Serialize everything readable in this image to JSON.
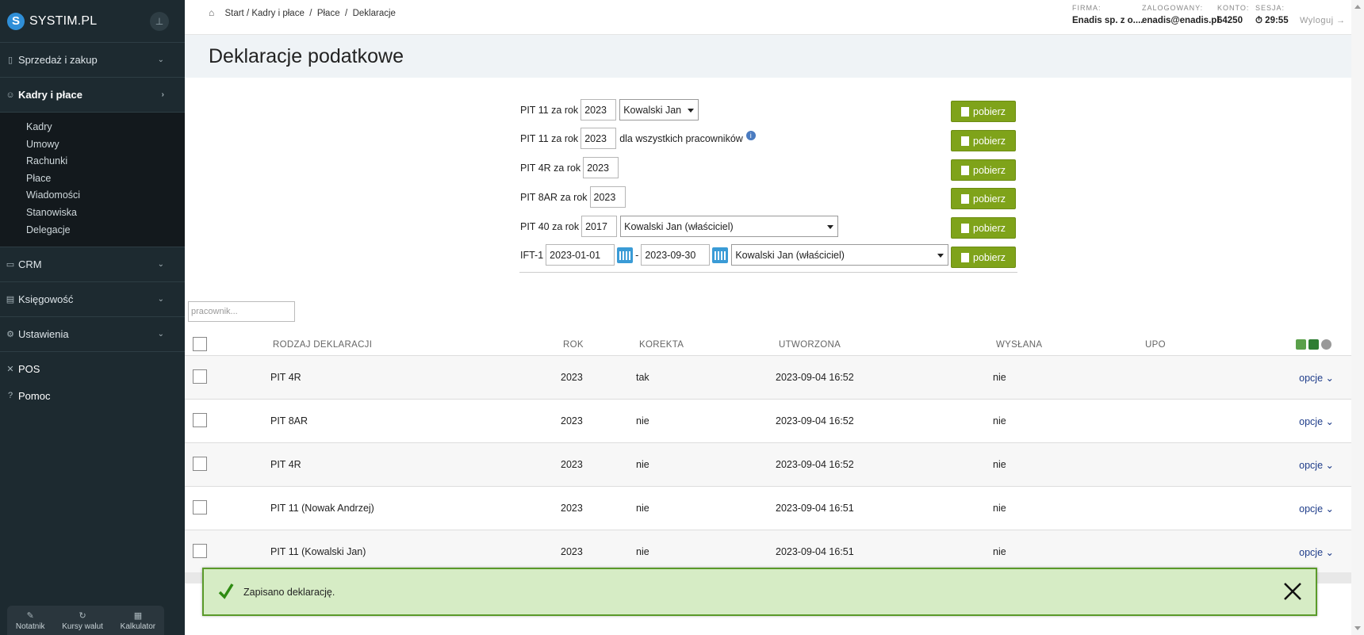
{
  "app": {
    "logo_letter": "S",
    "logo_text": "SYSTIM.PL",
    "pin_icon": "pin-icon"
  },
  "sidebar": {
    "items": [
      {
        "label": "Sprzedaż i zakup",
        "icon": "document-icon"
      },
      {
        "label": "Kadry i płace",
        "icon": "users-icon"
      },
      {
        "label": "CRM",
        "icon": "card-icon"
      },
      {
        "label": "Księgowość",
        "icon": "book-icon"
      },
      {
        "label": "Ustawienia",
        "icon": "gear-icon"
      },
      {
        "label": "POS",
        "icon": "tools-icon"
      },
      {
        "label": "Pomoc",
        "icon": "help-icon"
      }
    ],
    "submenu": [
      "Kadry",
      "Umowy",
      "Rachunki",
      "Płace",
      "Wiadomości",
      "Stanowiska",
      "Delegacje"
    ],
    "tools": [
      {
        "label": "Notatnik",
        "icon": "pencil-icon"
      },
      {
        "label": "Kursy walut",
        "icon": "refresh-icon"
      },
      {
        "label": "Kalkulator",
        "icon": "calculator-icon"
      }
    ]
  },
  "breadcrumb": {
    "start": "Start",
    "sep": "/",
    "kadry": "Kadry i płace",
    "place": "Płace",
    "current": "Deklaracje"
  },
  "header": {
    "firma_label": "FIRMA:",
    "firma_value": "Enadis sp. z o....",
    "zalogowany_label": "ZALOGOWANY:",
    "zalogowany_value": "enadis@enadis.pl",
    "konto_label": "KONTO:",
    "konto_value": "64250",
    "sesja_label": "SESJA:",
    "sesja_value": "29:55",
    "logout": "Wyloguj →"
  },
  "page_title": "Deklaracje podatkowe",
  "form": {
    "button_label": "pobierz",
    "rows": [
      {
        "label": "PIT 11 za rok",
        "year": "2023",
        "select": "Kowalski Jan"
      },
      {
        "label": "PIT 11 za rok",
        "year": "2023",
        "text": "dla wszystkich pracowników"
      },
      {
        "label": "PIT 4R za rok",
        "year": "2023"
      },
      {
        "label": "PIT 8AR za rok",
        "year": "2023"
      },
      {
        "label": "PIT 40 za rok",
        "year": "2017",
        "select": "Kowalski Jan (właściciel)"
      },
      {
        "label": "IFT-1",
        "date_from": "2023-01-01",
        "dash": "-",
        "date_to": "2023-09-30",
        "select": "Kowalski Jan (właściciel)"
      }
    ]
  },
  "search": {
    "placeholder": "pracownik..."
  },
  "table": {
    "headers": [
      "RODZAJ DEKLARACJI",
      "ROK",
      "KOREKTA",
      "UTWORZONA",
      "WYSŁANA",
      "UPO"
    ],
    "opcje_label": "opcje",
    "rows": [
      {
        "rodzaj": "PIT 4R",
        "rok": "2023",
        "korekta": "tak",
        "utworzona": "2023-09-04 16:52",
        "wyslana": "nie"
      },
      {
        "rodzaj": "PIT 8AR",
        "rok": "2023",
        "korekta": "nie",
        "utworzona": "2023-09-04 16:52",
        "wyslana": "nie"
      },
      {
        "rodzaj": "PIT 4R",
        "rok": "2023",
        "korekta": "nie",
        "utworzona": "2023-09-04 16:52",
        "wyslana": "nie"
      },
      {
        "rodzaj": "PIT 11 (Nowak Andrzej)",
        "rok": "2023",
        "korekta": "nie",
        "utworzona": "2023-09-04 16:51",
        "wyslana": "nie"
      },
      {
        "rodzaj": "PIT 11 (Kowalski Jan)",
        "rok": "2023",
        "korekta": "nie",
        "utworzona": "2023-09-04 16:51",
        "wyslana": "nie"
      }
    ]
  },
  "toast": {
    "message": "Zapisano deklarację."
  },
  "colors": {
    "sidebar": "#1d2a30",
    "accent_green": "#7fa31a",
    "toast_bg": "#d6ecc5",
    "link": "#1f3d8a"
  }
}
